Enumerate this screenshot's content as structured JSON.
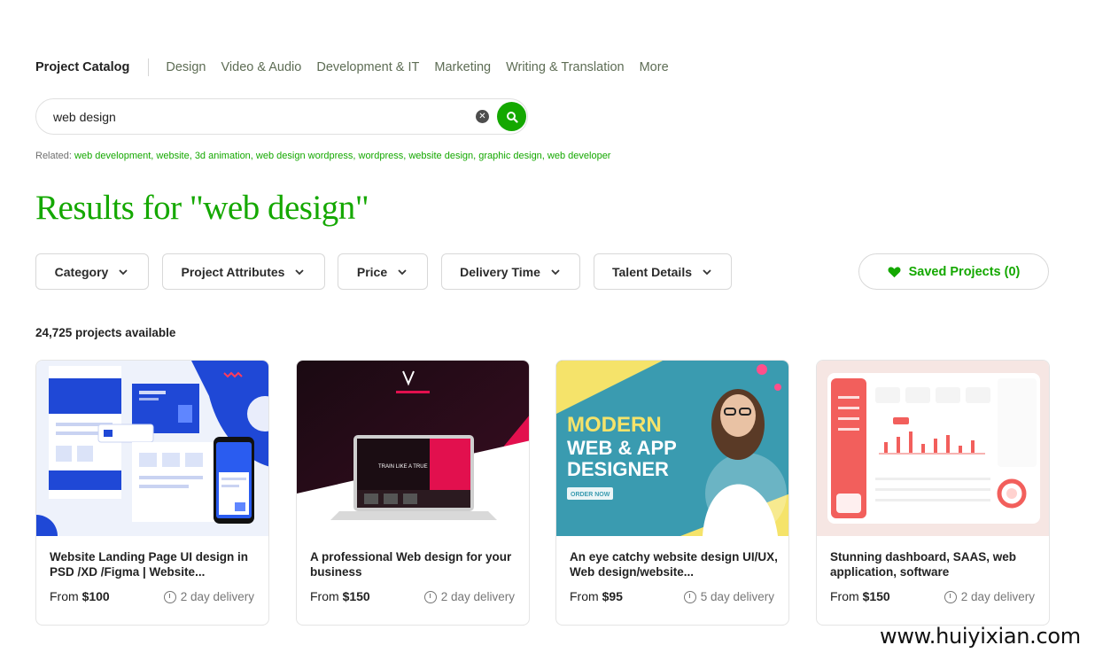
{
  "nav": {
    "brand": "Project Catalog",
    "items": [
      "Design",
      "Video & Audio",
      "Development & IT",
      "Marketing",
      "Writing & Translation",
      "More"
    ]
  },
  "search": {
    "value": "web design"
  },
  "related": {
    "label": "Related:",
    "links": [
      "web development,",
      "website,",
      "3d animation,",
      "web design wordpress,",
      "wordpress,",
      "website design,",
      "graphic design,",
      "web developer"
    ]
  },
  "results_title": "Results for \"web design\"",
  "filters": [
    "Category",
    "Project Attributes",
    "Price",
    "Delivery Time",
    "Talent Details"
  ],
  "saved_label": "Saved Projects (0)",
  "count_label": "24,725 projects available",
  "cards": [
    {
      "title": "Website Landing Page UI design in PSD /XD /Figma | Website...",
      "price_prefix": "From",
      "price": "$100",
      "delivery": "2 day delivery"
    },
    {
      "title": "A professional Web design for your business",
      "price_prefix": "From",
      "price": "$150",
      "delivery": "2 day delivery",
      "thumb_text": "TRAIN LIKE A TRUE"
    },
    {
      "title": "An eye catchy website design UI/UX, Web design/website...",
      "price_prefix": "From",
      "price": "$95",
      "delivery": "5 day delivery",
      "thumb_lines": [
        "MODERN",
        "WEB & APP",
        "DESIGNER"
      ],
      "thumb_cta": "ORDER NOW"
    },
    {
      "title": "Stunning dashboard, SAAS, web application, software",
      "price_prefix": "From",
      "price": "$150",
      "delivery": "2 day delivery"
    }
  ],
  "watermark": "www.huiyixian.com",
  "colors": {
    "accent": "#14a800",
    "thumb3_teal": "#3a9bb0",
    "thumb3_yellow": "#f5e36a"
  }
}
